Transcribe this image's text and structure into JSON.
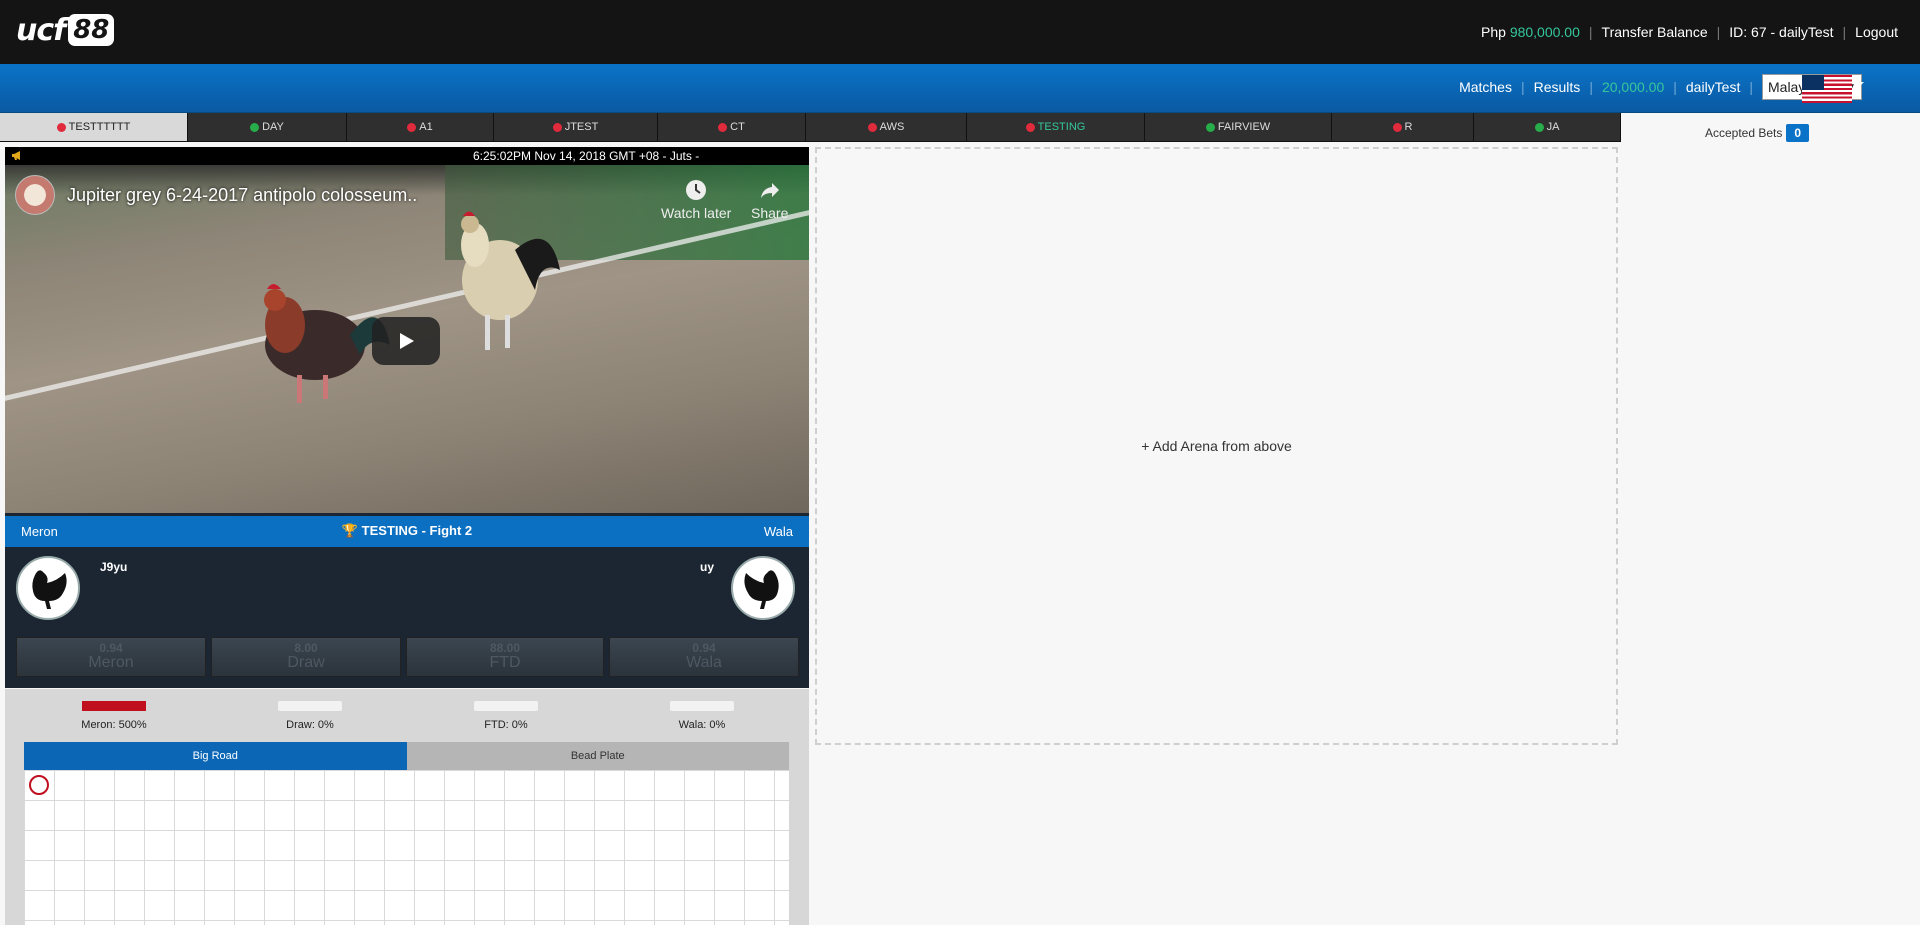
{
  "brand": {
    "logo_text": "ucf",
    "logo_number": "88"
  },
  "topnav": {
    "currency": "Php",
    "balance": "980,000.00",
    "transfer": "Transfer Balance",
    "account": "ID: 67 - dailyTest",
    "logout": "Logout"
  },
  "subnav": {
    "matches": "Matches",
    "results": "Results",
    "credit": "20,000.00",
    "username": "dailyTest",
    "language_selected": "Malay",
    "flag_icon": "us-flag-icon"
  },
  "arena_tabs": [
    {
      "label": "TESTTTTTT",
      "status": "red",
      "active": true
    },
    {
      "label": "DAY",
      "status": "green"
    },
    {
      "label": "A1",
      "status": "red"
    },
    {
      "label": "JTEST",
      "status": "red"
    },
    {
      "label": "CT",
      "status": "red"
    },
    {
      "label": "AWS",
      "status": "red"
    },
    {
      "label": "TESTING",
      "status": "red",
      "highlight": true
    },
    {
      "label": "FAIRVIEW",
      "status": "green"
    },
    {
      "label": "R",
      "status": "red"
    },
    {
      "label": "JA",
      "status": "green"
    }
  ],
  "accepted_bets": {
    "label": "Accepted Bets",
    "count": "0"
  },
  "player": {
    "clock": "6:25:02PM Nov 14, 2018 GMT +08 - Juts -",
    "video_title": "Jupiter grey 6-24-2017 antipolo colosseum..",
    "watch_later": "Watch later",
    "share": "Share"
  },
  "match": {
    "meron_label": "Meron",
    "wala_label": "Wala",
    "title": "TESTING - Fight 2",
    "meron_fighter": "J9yu",
    "wala_fighter": "uy"
  },
  "odds": [
    {
      "odd": "0.94",
      "name": "Meron"
    },
    {
      "odd": "8.00",
      "name": "Draw"
    },
    {
      "odd": "88.00",
      "name": "FTD"
    },
    {
      "odd": "0.94",
      "name": "Wala"
    }
  ],
  "stats": [
    {
      "label": "Meron: 500%",
      "fill": 1.0
    },
    {
      "label": "Draw: 0%",
      "fill": 0
    },
    {
      "label": "FTD: 0%",
      "fill": 0
    },
    {
      "label": "Wala: 0%",
      "fill": 0
    }
  ],
  "road_tabs": {
    "big_road": "Big Road",
    "bead_plate": "Bead Plate"
  },
  "empty_arena": "+ Add Arena from above",
  "colors": {
    "accent_blue": "#0a73c7",
    "status_red": "#e02b3c",
    "status_green": "#27ae4a",
    "balance_green": "#35c79b",
    "meron_red": "#c0101e"
  }
}
